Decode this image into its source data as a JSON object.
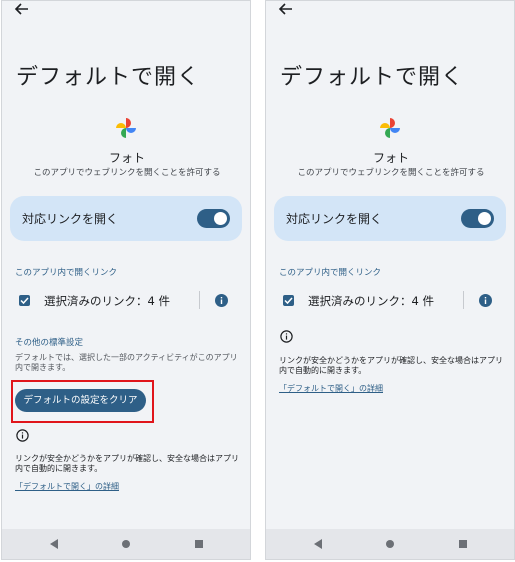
{
  "left_screen": {
    "page_title": "デフォルトで開く",
    "app_name": "フォト",
    "app_description": "このアプリでウェブリンクを開くことを許可する",
    "toggle_label": "対応リンクを開く",
    "toggle_on": true,
    "in_app_section_header": "このアプリ内で開くリンク",
    "selected_links_label": "選択済みのリンク：4 件",
    "other_defaults_header": "その他の標準設定",
    "other_defaults_description": "デフォルトでは、選択した一部のアクティビティがこのアプリ内で開きます。",
    "clear_button_label": "デフォルトの設定をクリア",
    "note_text": "リンクが安全かどうかをアプリが確認し、安全な場合はアプリ内で自動的に開きます。",
    "details_link": "「デフォルトで開く」の詳細"
  },
  "right_screen": {
    "page_title": "デフォルトで開く",
    "app_name": "フォト",
    "app_description": "このアプリでウェブリンクを開くことを許可する",
    "toggle_label": "対応リンクを開く",
    "toggle_on": true,
    "in_app_section_header": "このアプリ内で開くリンク",
    "selected_links_label": "選択済みのリンク：4 件",
    "note_text": "リンクが安全かどうかをアプリが確認し、安全な場合はアプリ内で自動的に開きます。",
    "details_link": "「デフォルトで開く」の詳細"
  },
  "icons": {
    "back": "arrow-back-icon",
    "app_logo": "google-photos-pinwheel-icon",
    "checkbox": "checkmark-icon",
    "info_filled": "info-filled-icon",
    "info_outline": "info-outline-icon",
    "nav_back": "triangle-back-icon",
    "nav_home": "circle-home-icon",
    "nav_recents": "square-recents-icon"
  },
  "colors": {
    "accent": "#2e5f87",
    "toggle_card_bg": "#d3e5f7",
    "screen_bg": "#f1f3f6",
    "highlight": "#e0151b"
  }
}
